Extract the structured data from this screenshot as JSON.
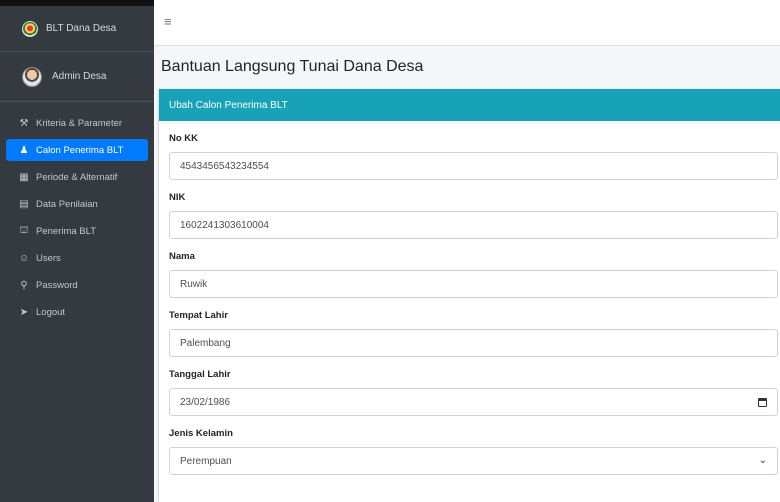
{
  "brand": {
    "title": "BLT Dana Desa"
  },
  "user": {
    "name": "Admin Desa"
  },
  "sidebar": {
    "items": [
      {
        "label": "Kriteria & Parameter",
        "icon": "wrench-icon"
      },
      {
        "label": "Calon Penerima BLT",
        "icon": "users-icon",
        "active": true
      },
      {
        "label": "Periode & Alternatif",
        "icon": "calendar-icon"
      },
      {
        "label": "Data Penilaian",
        "icon": "clipboard-icon"
      },
      {
        "label": "Penerima BLT",
        "icon": "person-dolly-icon"
      },
      {
        "label": "Users",
        "icon": "group-icon"
      },
      {
        "label": "Password",
        "icon": "key-icon"
      },
      {
        "label": "Logout",
        "icon": "sign-out-icon"
      }
    ]
  },
  "page": {
    "title": "Bantuan Langsung Tunai Dana Desa"
  },
  "card": {
    "title": "Ubah Calon Penerima BLT"
  },
  "form": {
    "no_kk": {
      "label": "No KK",
      "value": "4543456543234554"
    },
    "nik": {
      "label": "NIK",
      "value": "1602241303610004"
    },
    "nama": {
      "label": "Nama",
      "value": "Ruwik"
    },
    "tempat_lahir": {
      "label": "Tempat Lahir",
      "value": "Palembang"
    },
    "tanggal_lahir": {
      "label": "Tanggal Lahir",
      "value": "23/02/1986"
    },
    "jenis_kelamin": {
      "label": "Jenis Kelamin",
      "value": "Perempuan"
    }
  },
  "colors": {
    "sidebar": "#343a40",
    "active": "#007bff",
    "card_header": "#17a2b8"
  }
}
